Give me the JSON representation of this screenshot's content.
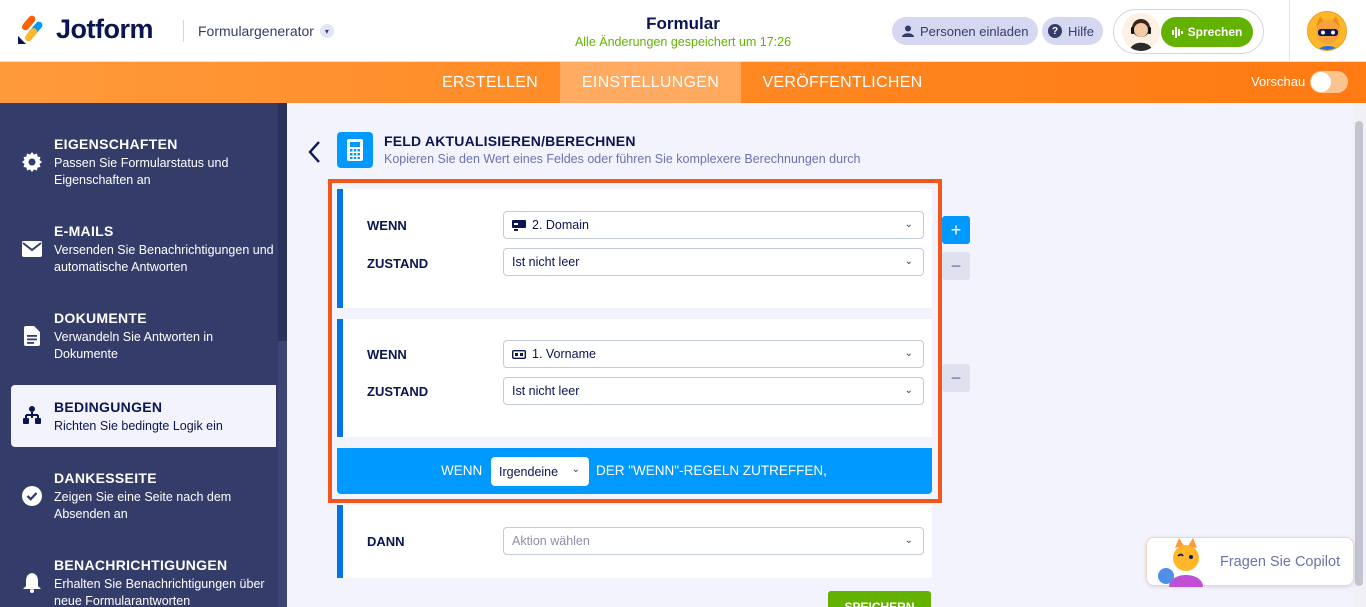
{
  "header": {
    "brand": "Jotform",
    "generator": "Formulargenerator",
    "form_title": "Formular",
    "saved_status": "Alle Änderungen gespeichert um 17:26",
    "invite_label": "Personen einladen",
    "help_label": "Hilfe",
    "speak_label": "Sprechen"
  },
  "tabs": [
    {
      "label": "ERSTELLEN",
      "active": false
    },
    {
      "label": "EINSTELLUNGEN",
      "active": true
    },
    {
      "label": "VERÖFFENTLICHEN",
      "active": false
    }
  ],
  "preview_label": "Vorschau",
  "sidebar": {
    "items": [
      {
        "title": "EIGENSCHAFTEN",
        "desc": "Passen Sie Formularstatus und Eigenschaften an",
        "icon": "gear-icon"
      },
      {
        "title": "E-MAILS",
        "desc": "Versenden Sie Benachrichtigungen und automatische Antworten",
        "icon": "envelope-icon"
      },
      {
        "title": "DOKUMENTE",
        "desc": "Verwandeln Sie Antworten in Dokumente",
        "icon": "document-icon"
      },
      {
        "title": "BEDINGUNGEN",
        "desc": "Richten Sie bedingte Logik ein",
        "icon": "sitemap-icon",
        "active": true
      },
      {
        "title": "DANKESSEITE",
        "desc": "Zeigen Sie eine Seite nach dem Absenden an",
        "icon": "check-circle-icon"
      },
      {
        "title": "BENACHRICHTIGUNGEN",
        "desc": "Erhalten Sie Benachrichtigungen über neue Formularantworten",
        "icon": "bell-icon"
      }
    ]
  },
  "condition": {
    "title": "FELD AKTUALISIEREN/BERECHNEN",
    "description": "Kopieren Sie den Wert eines Feldes oder führen Sie komplexere Berechnungen durch",
    "rules": [
      {
        "if_label": "WENN",
        "field": "2. Domain",
        "state_label": "ZUSTAND",
        "state": "Ist nicht leer"
      },
      {
        "if_label": "WENN",
        "field": "1. Vorname",
        "state_label": "ZUSTAND",
        "state": "Ist nicht leer"
      }
    ],
    "match_prefix": "WENN",
    "match_value": "Irgendeine",
    "match_suffix": "DER \"WENN\"-REGELN ZUTREFFEN,",
    "then_label": "DANN",
    "action_placeholder": "Aktion wählen",
    "save_label": "SPEICHERN"
  },
  "copilot_label": "Fragen Sie Copilot",
  "colors": {
    "accent_orange": "#ff8a24",
    "navy": "#343c6a",
    "blue": "#0099ff",
    "green": "#64b200",
    "highlight": "#f2561d"
  }
}
